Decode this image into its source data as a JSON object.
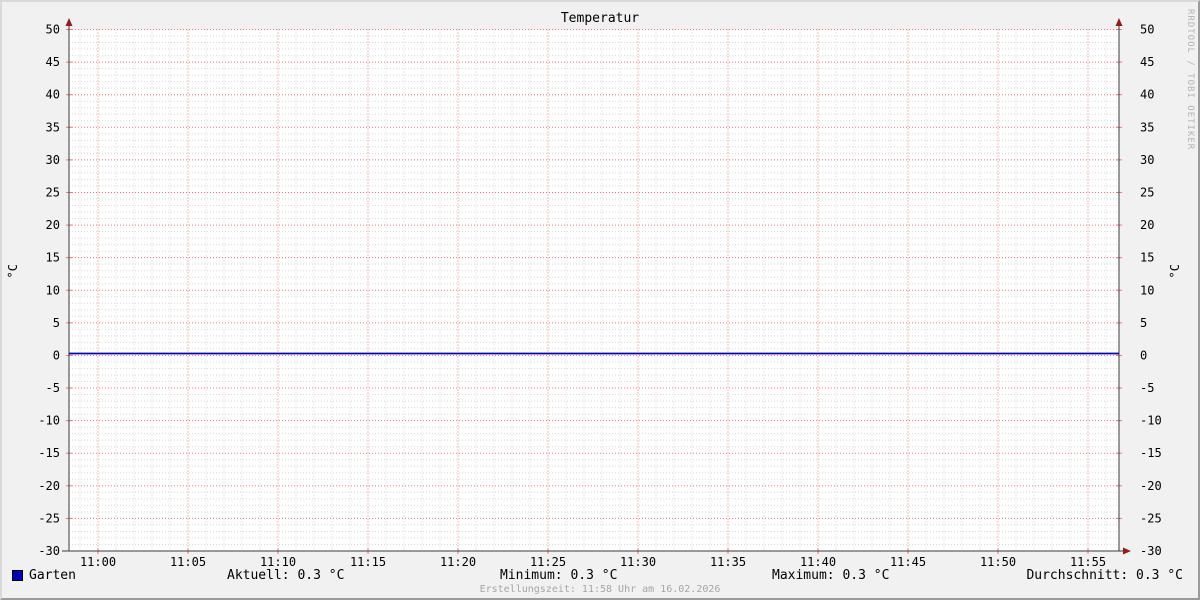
{
  "title": "Temperatur",
  "watermark": "RRDTOOL / TOBI OETIKER",
  "axes": {
    "y_unit_left": "°C",
    "y_unit_right": "°C"
  },
  "legend": {
    "series_label": "Garten",
    "stats": {
      "aktuell": "Aktuell: 0.3 °C",
      "minimum": "Minimum: 0.3 °C",
      "maximum": "Maximum: 0.3 °C",
      "durchschnitt": "Durchschnitt: 0.3 °C"
    }
  },
  "footer": "Erstellungszeit: 11:58 Uhr am 16.02.2026",
  "colors": {
    "background": "#f1f1f1",
    "plot_background": "#ffffff",
    "major_grid": "#e87a7a",
    "minor_grid": "#d8d8d8",
    "axis": "#3a3a3a",
    "arrow": "#8f1f1f",
    "series": "#0000b4",
    "text": "#000000",
    "muted": "#a6a6a6"
  },
  "chart_data": {
    "type": "line",
    "title": "Temperatur",
    "xlabel": "",
    "ylabel": "°C",
    "ylim": [
      -30,
      50
    ],
    "y_major_step": 5,
    "y_minor_step": 1,
    "y_tick_labels": [
      "50",
      "45",
      "40",
      "35",
      "30",
      "25",
      "20",
      "15",
      "10",
      "5",
      "0",
      "-5",
      "-10",
      "-15",
      "-20",
      "-25",
      "-30"
    ],
    "x_tick_labels": [
      "11:00",
      "11:05",
      "11:10",
      "11:15",
      "11:20",
      "11:25",
      "11:30",
      "11:35",
      "11:40",
      "11:45",
      "11:50",
      "11:55"
    ],
    "x_minor_per_major": 5,
    "grid": true,
    "legend_position": "bottom",
    "series": [
      {
        "name": "Garten",
        "color": "#0000b4",
        "x": [
          "11:00",
          "11:05",
          "11:10",
          "11:15",
          "11:20",
          "11:25",
          "11:30",
          "11:35",
          "11:40",
          "11:45",
          "11:50",
          "11:55"
        ],
        "values": [
          0.3,
          0.3,
          0.3,
          0.3,
          0.3,
          0.3,
          0.3,
          0.3,
          0.3,
          0.3,
          0.3,
          0.3
        ],
        "constant": true
      }
    ],
    "stats": {
      "aktuell_c": 0.3,
      "minimum_c": 0.3,
      "maximum_c": 0.3,
      "durchschnitt_c": 0.3
    }
  }
}
